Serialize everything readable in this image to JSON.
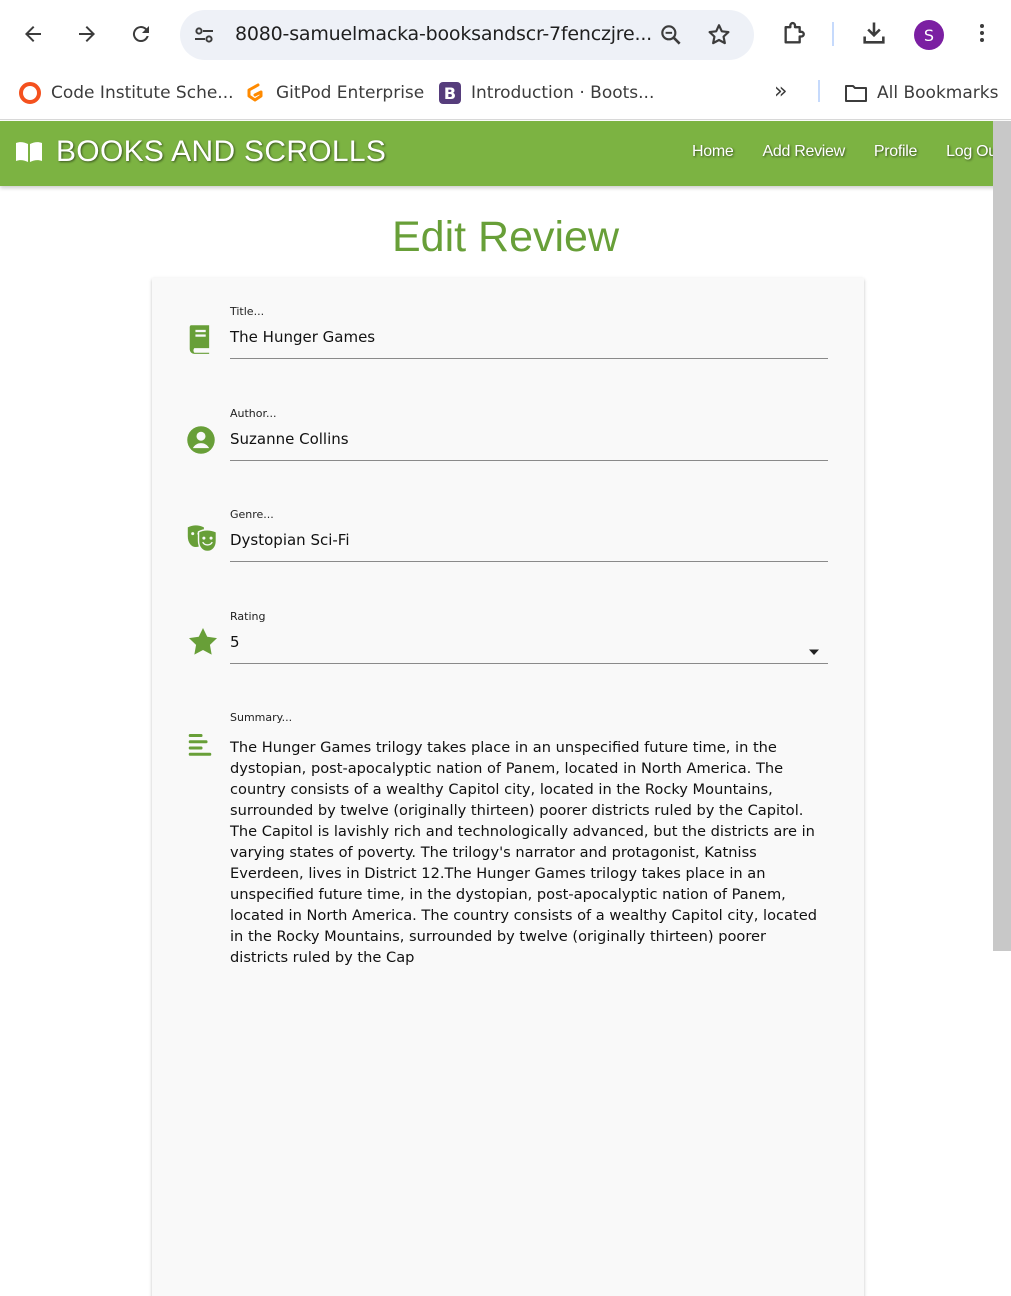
{
  "browser": {
    "url": "8080-samuelmacka-booksandscr-7fenczjre...",
    "profile_initial": "S",
    "bookmarks": [
      {
        "label": "Code Institute Sche..."
      },
      {
        "label": "GitPod Enterprise"
      },
      {
        "label": "Introduction · Boots..."
      }
    ],
    "all_bookmarks_label": "All Bookmarks",
    "overflow_label": "»"
  },
  "navbar": {
    "brand": "BOOKS AND SCROLLS",
    "links": [
      "Home",
      "Add Review",
      "Profile",
      "Log Out"
    ]
  },
  "page": {
    "title": "Edit Review"
  },
  "form": {
    "title": {
      "label": "Title...",
      "value": "The Hunger Games",
      "icon": "book-icon"
    },
    "author": {
      "label": "Author...",
      "value": "Suzanne Collins",
      "icon": "account-circle-icon"
    },
    "genre": {
      "label": "Genre...",
      "value": "Dystopian Sci-Fi",
      "icon": "theater-masks-icon"
    },
    "rating": {
      "label": "Rating",
      "value": "5",
      "icon": "star-icon"
    },
    "summary": {
      "label": "Summary...",
      "icon": "notes-icon",
      "value": "The Hunger Games trilogy takes place in an unspecified future time, in the dystopian, post-apocalyptic nation of Panem, located in North America. The country consists of a wealthy Capitol city, located in the Rocky Mountains, surrounded by twelve (originally thirteen) poorer districts ruled by the Capitol. The Capitol is lavishly rich and technologically advanced, but the districts are in varying states of poverty. The trilogy's narrator and protagonist, Katniss Everdeen, lives in District 12.The Hunger Games trilogy takes place in an unspecified future time, in the dystopian, post-apocalyptic nation of Panem, located in North America. The country consists of a wealthy Capitol city, located in the Rocky Mountains, surrounded by twelve (originally thirteen) poorer districts ruled by the Cap"
    }
  },
  "colors": {
    "navbar": "#7cb342",
    "accent": "#689f38",
    "avatar": "#7b1fa2"
  }
}
